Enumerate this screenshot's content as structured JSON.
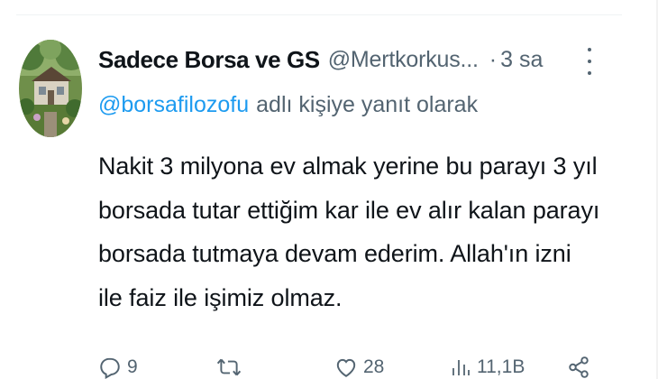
{
  "tweet": {
    "display_name": "Sadece Borsa ve GS",
    "handle": "@Mertkorkus...",
    "separator": "·",
    "time": "3 sa",
    "reply": {
      "mention": "@borsafilozofu",
      "suffix": "adlı kişiye yanıt olarak"
    },
    "text_lines": [
      "Nakit 3 milyona ev almak yerine bu parayı 3 yıl",
      "borsada tutar ettiğim kar ile ev alır kalan parayı",
      "borsada tutmaya devam ederim. Allah'ın izni",
      "ile faiz ile işimiz olmaz."
    ],
    "actions": {
      "replies": "9",
      "reposts": "",
      "likes": "28",
      "views": "11,1B"
    }
  },
  "icons": {
    "more": "more-vertical-icon",
    "reply": "reply-icon",
    "repost": "repost-icon",
    "like": "heart-icon",
    "views": "views-icon",
    "share": "share-icon"
  },
  "colors": {
    "text": "#0f1419",
    "secondary": "#536471",
    "link": "#1d9bf0",
    "divider": "#eff3f4"
  }
}
